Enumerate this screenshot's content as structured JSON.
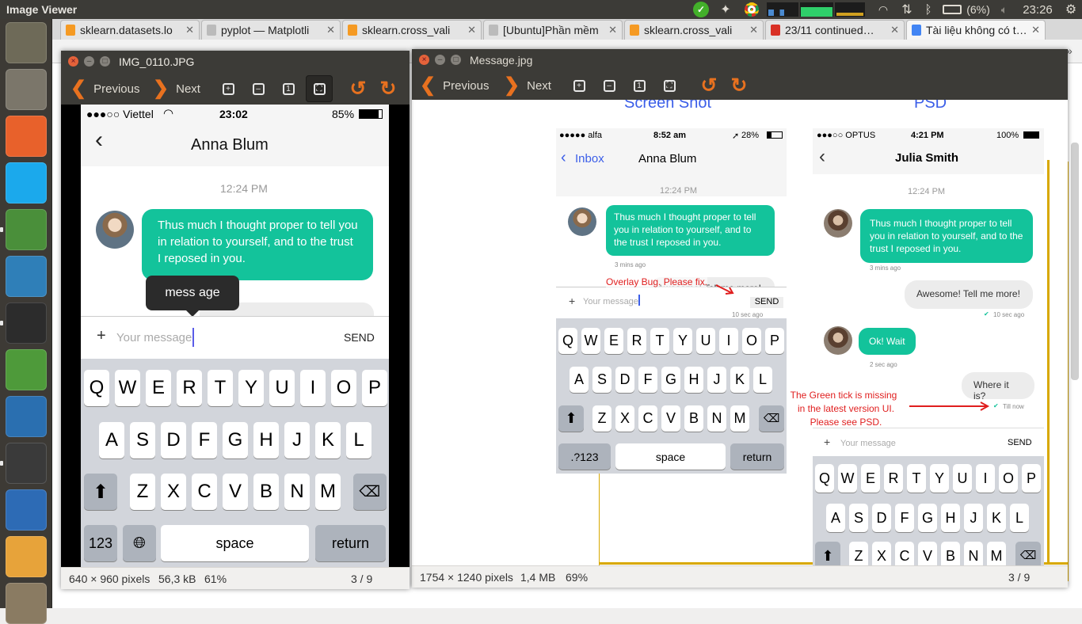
{
  "topbar": {
    "app_title": "Image Viewer",
    "battery": "(6%)",
    "clock": "23:26"
  },
  "launcher": {
    "items": [
      {
        "icon": "ubuntu-dash-icon",
        "color": "#6e6a58"
      },
      {
        "icon": "files-icon",
        "color": "#7b766a"
      },
      {
        "icon": "postman-icon",
        "color": "#e8612b"
      },
      {
        "icon": "skype-icon",
        "color": "#1ba9ec"
      },
      {
        "icon": "chrome-icon",
        "color": "#4a8f3a"
      },
      {
        "icon": "network-globe-icon",
        "color": "#2f7fb8"
      },
      {
        "icon": "terminal-icon",
        "color": "#2c2c2c"
      },
      {
        "icon": "drawing-tool-icon",
        "color": "#4e9a3a"
      },
      {
        "icon": "libreoffice-impress-icon",
        "color": "#2a6fb0"
      },
      {
        "icon": "sublime-text-icon",
        "color": "#3a3a3a"
      },
      {
        "icon": "libreoffice-writer-icon",
        "color": "#2d6bb5"
      },
      {
        "icon": "system-monitor-icon",
        "color": "#e7a33a"
      },
      {
        "icon": "gallery-icon",
        "color": "#8a7b62"
      }
    ]
  },
  "browser": {
    "tabs": [
      {
        "label": "sklearn.datasets.lo",
        "fav": "#f59a23",
        "active": false
      },
      {
        "label": "pyplot — Matplotli",
        "fav": "#bbbbbb",
        "active": false
      },
      {
        "label": "sklearn.cross_vali",
        "fav": "#f59a23",
        "active": false
      },
      {
        "label": "[Ubuntu]Phần mềm",
        "fav": "#bbbbbb",
        "active": false
      },
      {
        "label": "sklearn.cross_vali",
        "fav": "#f59a23",
        "active": false
      },
      {
        "label": "23/11 continued…",
        "fav": "#d93025",
        "active": false
      },
      {
        "label": "Tài liệu không có tiêu",
        "fav": "#4285f4",
        "active": true
      }
    ]
  },
  "viewer_left": {
    "title": "IMG_0110.JPG",
    "prev_label": "Previous",
    "next_label": "Next",
    "status_dims": "640 × 960 pixels",
    "status_size": "56,3 kB",
    "status_zoom": "61%",
    "status_index": "3 / 9",
    "phone": {
      "carrier": "●●●○○ Viettel",
      "time": "23:02",
      "battery": "85%",
      "contact": "Anna Blum",
      "timestamp": "12:24 PM",
      "message": "Thus much I thought proper to tell you in relation to yourself, and to the trust I reposed in you.",
      "tooltip": "mess age",
      "input_placeholder": "Your message",
      "send": "SEND",
      "keys_row1": [
        "Q",
        "W",
        "E",
        "R",
        "T",
        "Y",
        "U",
        "I",
        "O",
        "P"
      ],
      "keys_row2": [
        "A",
        "S",
        "D",
        "F",
        "G",
        "H",
        "J",
        "K",
        "L"
      ],
      "keys_row3": [
        "Z",
        "X",
        "C",
        "V",
        "B",
        "N",
        "M"
      ],
      "key_123": "123",
      "key_space": "space",
      "key_return": "return"
    }
  },
  "viewer_right": {
    "title": "Message.jpg",
    "prev_label": "Previous",
    "next_label": "Next",
    "status_dims": "1754 × 1240 pixels",
    "status_size": "1,4 MB",
    "status_zoom": "69%",
    "status_index": "3 / 9",
    "heading_left": "Screen Shot",
    "heading_right": "PSD",
    "screenshot": {
      "carrier": "●●●●● alfa",
      "time": "8:52 am",
      "battery": "28%",
      "back_label": "Inbox",
      "contact": "Anna Blum",
      "timestamp": "12:24 PM",
      "message": "Thus much I thought proper to tell you in relation to yourself, and to the trust I reposed in you.",
      "message_time": "3 mins ago",
      "annotation": "Overlay Bug. Please fix.",
      "hidden_reply": "Awesome! Tell me more!",
      "input_placeholder": "Your message",
      "send": "SEND",
      "sub_time": "10 sec ago",
      "keys_row1": [
        "Q",
        "W",
        "E",
        "R",
        "T",
        "Y",
        "U",
        "I",
        "O",
        "P"
      ],
      "keys_row2": [
        "A",
        "S",
        "D",
        "F",
        "G",
        "H",
        "J",
        "K",
        "L"
      ],
      "keys_row3": [
        "Z",
        "X",
        "C",
        "V",
        "B",
        "N",
        "M"
      ],
      "key_123": ".?123",
      "key_space": "space",
      "key_return": "return"
    },
    "psd": {
      "carrier": "●●●○○ OPTUS",
      "time": "4:21 PM",
      "battery": "100%",
      "contact": "Julia Smith",
      "timestamp": "12:24 PM",
      "message": "Thus much I thought proper to tell you in relation to yourself, and to the trust I reposed in you.",
      "message_time": "3 mins ago",
      "reply": "Awesome! Tell me more!",
      "reply_time": "10 sec ago",
      "incoming2": "Ok! Wait",
      "incoming2_time": "2 sec ago",
      "outgoing2": "Where it is?",
      "outgoing2_time": "Till now",
      "annotation_lines": [
        "The Green tick is missing",
        "in the latest version UI.",
        "Please see PSD."
      ],
      "input_placeholder": "Your message",
      "send": "SEND",
      "keys_row1": [
        "Q",
        "W",
        "E",
        "R",
        "T",
        "Y",
        "U",
        "I",
        "O",
        "P"
      ],
      "keys_row2": [
        "A",
        "S",
        "D",
        "F",
        "G",
        "H",
        "J",
        "K",
        "L"
      ],
      "keys_row3": [
        "Z",
        "X",
        "C",
        "V",
        "B",
        "N",
        "M"
      ]
    }
  },
  "colors": {
    "bubble_green": "#13c39b",
    "accent_orange": "#e8711f",
    "annotation_red": "#e01e1e",
    "link_blue": "#3b5ee8"
  }
}
